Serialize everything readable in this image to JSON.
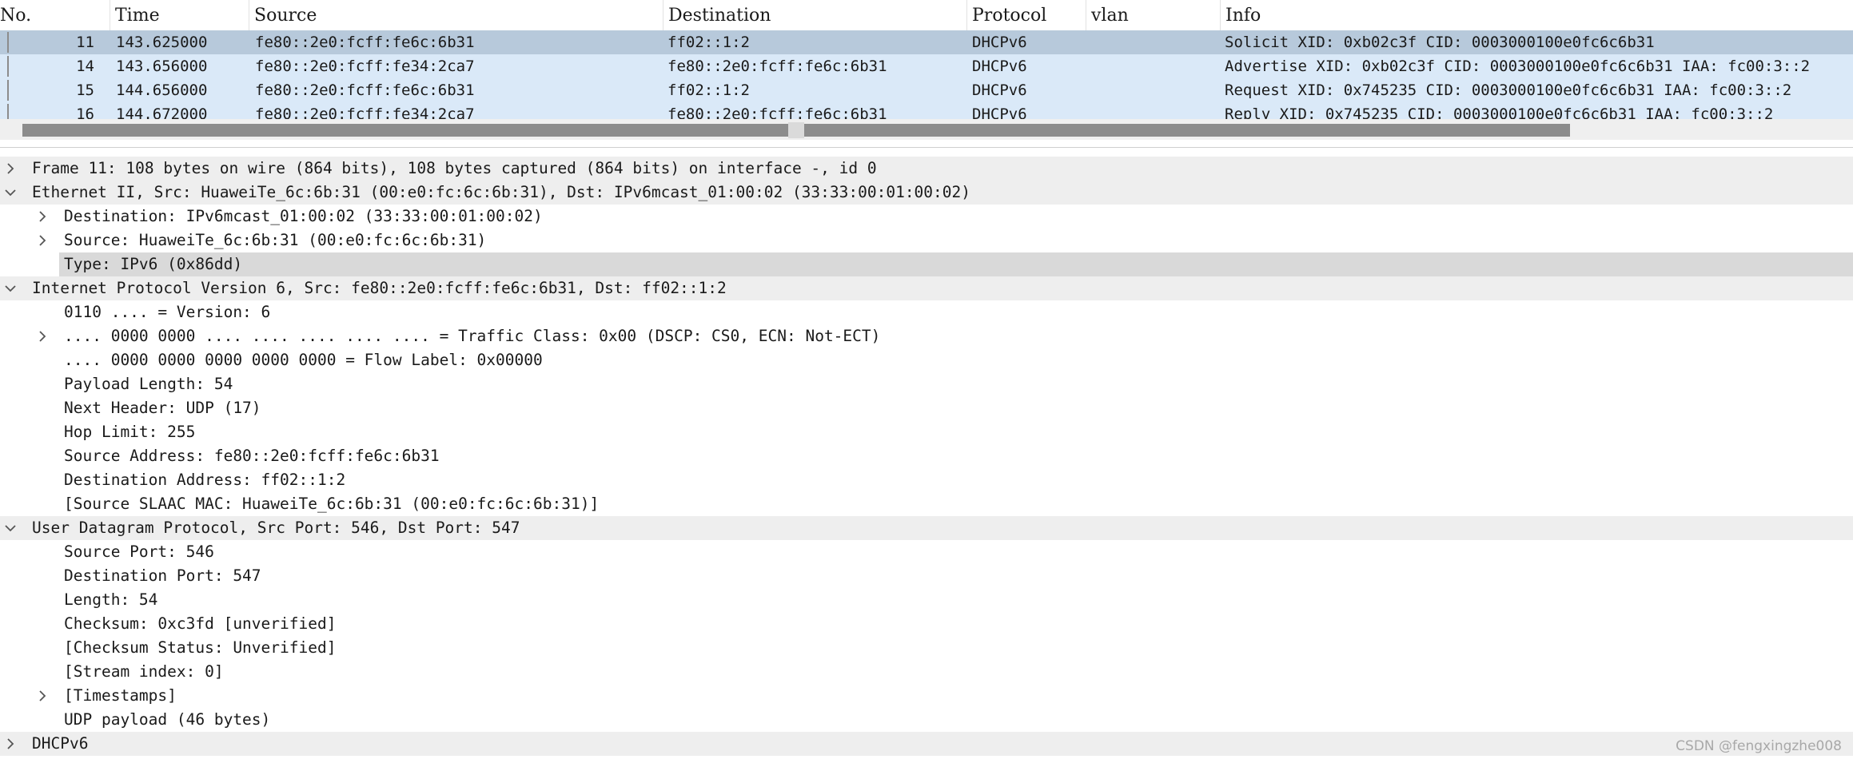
{
  "packet_list": {
    "columns": [
      "No.",
      "Time",
      "Source",
      "Destination",
      "Protocol",
      "vlan",
      "Info"
    ],
    "rows": [
      {
        "no": "11",
        "time": "143.625000",
        "source": "fe80::2e0:fcff:fe6c:6b31",
        "destination": "ff02::1:2",
        "protocol": "DHCPv6",
        "vlan": "",
        "info": "Solicit XID: 0xb02c3f CID: 0003000100e0fc6c6b31",
        "selected": true
      },
      {
        "no": "14",
        "time": "143.656000",
        "source": "fe80::2e0:fcff:fe34:2ca7",
        "destination": "fe80::2e0:fcff:fe6c:6b31",
        "protocol": "DHCPv6",
        "vlan": "",
        "info": "Advertise XID: 0xb02c3f CID: 0003000100e0fc6c6b31 IAA: fc00:3::2",
        "selected": false
      },
      {
        "no": "15",
        "time": "144.656000",
        "source": "fe80::2e0:fcff:fe6c:6b31",
        "destination": "ff02::1:2",
        "protocol": "DHCPv6",
        "vlan": "",
        "info": "Request XID: 0x745235 CID: 0003000100e0fc6c6b31 IAA: fc00:3::2",
        "selected": false
      },
      {
        "no": "16",
        "time": "144.672000",
        "source": "fe80::2e0:fcff:fe34:2ca7",
        "destination": "fe80::2e0:fcff:fe6c:6b31",
        "protocol": "DHCPv6",
        "vlan": "",
        "info": "Reply XID: 0x745235 CID: 0003000100e0fc6c6b31 IAA: fc00:3::2",
        "selected": false
      }
    ]
  },
  "details": [
    {
      "level": 0,
      "toggle": "collapsed",
      "text": "Frame 11: 108 bytes on wire (864 bits), 108 bytes captured (864 bits) on interface -, id 0",
      "header": true
    },
    {
      "level": 0,
      "toggle": "expanded",
      "text": "Ethernet II, Src: HuaweiTe_6c:6b:31 (00:e0:fc:6c:6b:31), Dst: IPv6mcast_01:00:02 (33:33:00:01:00:02)",
      "header": true
    },
    {
      "level": 1,
      "toggle": "collapsed",
      "text": "Destination: IPv6mcast_01:00:02 (33:33:00:01:00:02)"
    },
    {
      "level": 1,
      "toggle": "collapsed",
      "text": "Source: HuaweiTe_6c:6b:31 (00:e0:fc:6c:6b:31)"
    },
    {
      "level": 1,
      "toggle": "none",
      "text": "Type: IPv6 (0x86dd)",
      "highlighted": true
    },
    {
      "level": 0,
      "toggle": "expanded",
      "text": "Internet Protocol Version 6, Src: fe80::2e0:fcff:fe6c:6b31, Dst: ff02::1:2",
      "header": true
    },
    {
      "level": 1,
      "toggle": "none",
      "text": "0110 .... = Version: 6"
    },
    {
      "level": 1,
      "toggle": "collapsed",
      "text": ".... 0000 0000 .... .... .... .... .... = Traffic Class: 0x00 (DSCP: CS0, ECN: Not-ECT)"
    },
    {
      "level": 1,
      "toggle": "none",
      "text": ".... 0000 0000 0000 0000 0000 = Flow Label: 0x00000"
    },
    {
      "level": 1,
      "toggle": "none",
      "text": "Payload Length: 54"
    },
    {
      "level": 1,
      "toggle": "none",
      "text": "Next Header: UDP (17)"
    },
    {
      "level": 1,
      "toggle": "none",
      "text": "Hop Limit: 255"
    },
    {
      "level": 1,
      "toggle": "none",
      "text": "Source Address: fe80::2e0:fcff:fe6c:6b31"
    },
    {
      "level": 1,
      "toggle": "none",
      "text": "Destination Address: ff02::1:2"
    },
    {
      "level": 1,
      "toggle": "none",
      "text": "[Source SLAAC MAC: HuaweiTe_6c:6b:31 (00:e0:fc:6c:6b:31)]"
    },
    {
      "level": 0,
      "toggle": "expanded",
      "text": "User Datagram Protocol, Src Port: 546, Dst Port: 547",
      "header": true
    },
    {
      "level": 1,
      "toggle": "none",
      "text": "Source Port: 546"
    },
    {
      "level": 1,
      "toggle": "none",
      "text": "Destination Port: 547"
    },
    {
      "level": 1,
      "toggle": "none",
      "text": "Length: 54"
    },
    {
      "level": 1,
      "toggle": "none",
      "text": "Checksum: 0xc3fd [unverified]"
    },
    {
      "level": 1,
      "toggle": "none",
      "text": "[Checksum Status: Unverified]"
    },
    {
      "level": 1,
      "toggle": "none",
      "text": "[Stream index: 0]"
    },
    {
      "level": 1,
      "toggle": "collapsed",
      "text": "[Timestamps]"
    },
    {
      "level": 1,
      "toggle": "none",
      "text": "UDP payload (46 bytes)"
    },
    {
      "level": 0,
      "toggle": "collapsed",
      "text": "DHCPv6",
      "header": true
    }
  ],
  "watermark": "CSDN @fengxingzhe008",
  "colors": {
    "row_bg": "#dae9f8",
    "row_selected_bg": "#b7c9db",
    "tree_header_bg": "#eeeeee",
    "tree_highlight_bg": "#d9d9d9"
  },
  "icons": {
    "collapsed": "chevron-right-icon",
    "expanded": "chevron-down-icon"
  }
}
